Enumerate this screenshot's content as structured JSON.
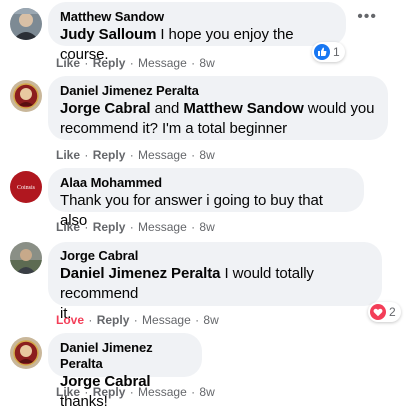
{
  "comments": [
    {
      "author": "Matthew Sandow",
      "mention": "Judy Salloum",
      "text_after": " I hope you enjoy the course.",
      "actions": {
        "reaction": "Like",
        "reply": "Reply",
        "message": "Message",
        "time": "8w"
      },
      "reaction_count": "1",
      "reaction_icon": "like-icon"
    },
    {
      "author": "Daniel Jimenez Peralta",
      "mention1": "Jorge Cabral",
      "connector": " and ",
      "mention2": "Matthew Sandow",
      "text_line1_end": " would you",
      "text_line2": "recommend it? I'm a total beginner",
      "actions": {
        "reaction": "Like",
        "reply": "Reply",
        "message": "Message",
        "time": "8w"
      }
    },
    {
      "author": "Alaa Mohammed",
      "text": "Thank you for answer i going to buy that also",
      "actions": {
        "reaction": "Like",
        "reply": "Reply",
        "message": "Message",
        "time": "8w"
      }
    },
    {
      "author": "Jorge Cabral",
      "mention": "Daniel Jimenez Peralta",
      "text_line1_end": " I would totally recommend",
      "text_line2": "it.",
      "actions": {
        "reaction": "Love",
        "reply": "Reply",
        "message": "Message",
        "time": "8w"
      },
      "reaction_count": "2",
      "reaction_icon": "love-icon"
    },
    {
      "author": "Daniel Jimenez Peralta",
      "mention": "Jorge Cabral",
      "text_after": " thanks!",
      "actions": {
        "reaction": "Like",
        "reply": "Reply",
        "message": "Message",
        "time": "8w"
      }
    }
  ],
  "more_options_label": "•••",
  "separator": " · ",
  "colors": {
    "like": "#1877f2",
    "love": "#f33e58",
    "bubble": "#f0f2f5",
    "meta": "#65676b"
  }
}
